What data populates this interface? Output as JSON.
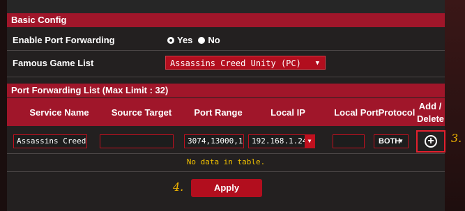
{
  "basic_config": {
    "header": "Basic Config",
    "enable_label": "Enable Port Forwarding",
    "yes_label": "Yes",
    "no_label": "No",
    "selected": "Yes",
    "famous_label": "Famous Game List",
    "game_selected": "Assassins Creed Unity (PC)"
  },
  "list": {
    "header": "Port Forwarding List (Max Limit : 32)",
    "columns": [
      "Service Name",
      "Source Target",
      "Port Range",
      "Local IP",
      "Local Port",
      "Protocol",
      "Add / Delete"
    ],
    "row": {
      "service_name": "Assassins Creed",
      "source_target": "",
      "port_range": "3074,13000,1",
      "local_ip": "192.168.1.24",
      "local_port": "",
      "protocol": "BOTH"
    },
    "empty_text": "No data in table."
  },
  "apply_label": "Apply",
  "annotations": {
    "step3": "3.",
    "step4": "4."
  },
  "colors": {
    "accent": "#a0162a",
    "annotation": "#f0b400",
    "empty_text": "#f0c000"
  }
}
